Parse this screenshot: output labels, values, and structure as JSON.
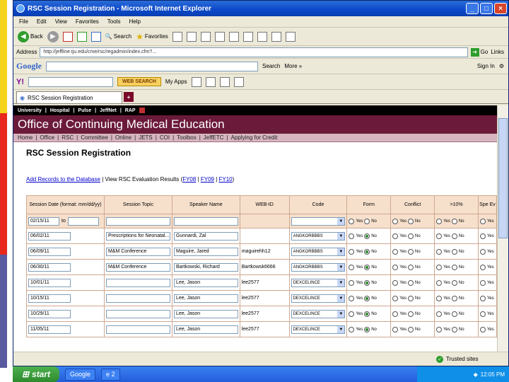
{
  "window": {
    "title": "RSC Session Registration - Microsoft Internet Explorer"
  },
  "menu": [
    "File",
    "Edit",
    "View",
    "Favorites",
    "Tools",
    "Help"
  ],
  "toolbar": {
    "back": "Back",
    "search": "Search",
    "favorites": "Favorites"
  },
  "address": {
    "label": "Address",
    "url": "http://jeffline.tju.edu/cme/rsc/regadmin/index.cfm?...",
    "go": "Go",
    "links": "Links"
  },
  "googlebar": {
    "logo": "Google",
    "search": "Search",
    "more": "More »",
    "signin": "Sign In"
  },
  "yahoobar": {
    "logo": "Y!",
    "web_search": "WEB SEARCH",
    "my_apps": "My Apps"
  },
  "tab": {
    "label": "RSC Session Registration"
  },
  "site": {
    "top_links": [
      "University",
      "|",
      "Hospital",
      "|",
      "Pulse",
      "|",
      "JeffNet",
      "|",
      "RAP"
    ],
    "banner": "Office of Continuing Medical Education",
    "nav": [
      "Home",
      "|",
      "Office",
      "|",
      "RSC",
      "|",
      "Committee",
      "|",
      "Online",
      "|",
      "JETS",
      "|",
      "COI",
      "|",
      "Toolbox",
      "|",
      "JeffETC",
      "|",
      "Applying for Credit"
    ],
    "page_title": "RSC Session Registration",
    "links": {
      "add": "Add Records to the Database",
      "view_prefix": "View RSC Evaluation Results (",
      "fy08": "FY08",
      "fy09": "FY09",
      "fy10": "FY10",
      "view_suffix": ")"
    }
  },
  "table": {
    "headers": [
      "Session Date (format: mm/dd/yy)",
      "Session Topic",
      "Speaker Name",
      "WEB-ID",
      "Code",
      "Form",
      "Conflict",
      ">10%",
      "Spe Ev"
    ],
    "filter": {
      "date_from": "02/15/11",
      "to_label": "to"
    },
    "yes": "Yes",
    "no": "No",
    "rows": [
      {
        "date": "06/02/11",
        "topic": "Prescriptions for Neonatal...",
        "speaker": "Gunnardi, Zal",
        "webid": "",
        "code": "ANGKORBBBS"
      },
      {
        "date": "06/09/11",
        "topic": "M&M Conference",
        "speaker": "Maguire, Jared",
        "webid": "maguirehh12",
        "code": "ANGKORBBBS"
      },
      {
        "date": "06/30/11",
        "topic": "M&M Conference",
        "speaker": "Bartkowski, Richard",
        "webid": "Bartkowsk6666",
        "code": "ANGKORBBBS"
      },
      {
        "date": "10/01/11",
        "topic": "",
        "speaker": "Lee, Jason",
        "webid": "lee2577",
        "code": "DEXCELINCE"
      },
      {
        "date": "10/15/11",
        "topic": "",
        "speaker": "Lee, Jason",
        "webid": "lee2577",
        "code": "DEXCELINCE"
      },
      {
        "date": "10/29/11",
        "topic": "",
        "speaker": "Lee, Jason",
        "webid": "lee2577",
        "code": "DEXCELINCE"
      },
      {
        "date": "11/05/11",
        "topic": "",
        "speaker": "Lee, Jason",
        "webid": "lee2577",
        "code": "DEXCELINCE"
      }
    ]
  },
  "status": {
    "trusted": "Trusted sites"
  },
  "taskbar": {
    "start": "start",
    "google": "Google",
    "tab_count": "2",
    "clock": "12:05 PM"
  }
}
